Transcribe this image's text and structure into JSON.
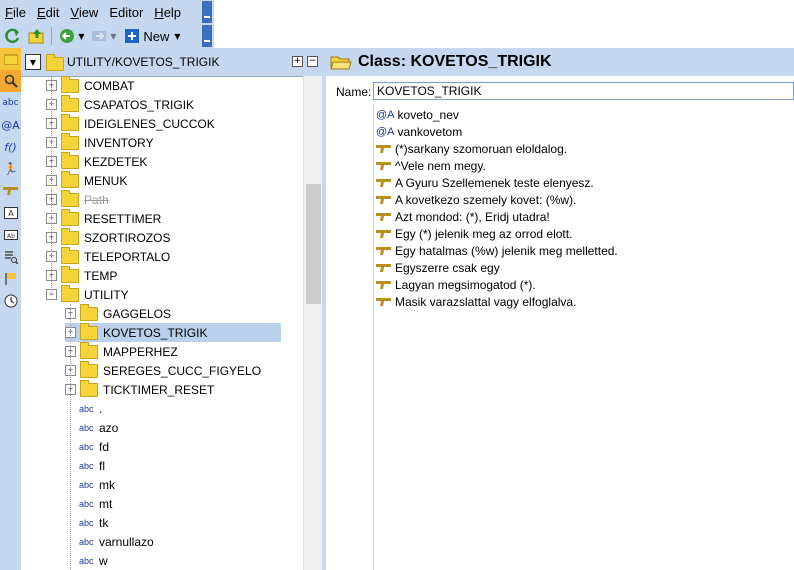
{
  "menu": {
    "items": [
      {
        "label": "File",
        "u": "F",
        "rest": "ile"
      },
      {
        "label": "Edit",
        "u": "E",
        "rest": "dit"
      },
      {
        "label": "View",
        "u": "V",
        "rest": "iew"
      },
      {
        "label": "Editor",
        "u": "",
        "rest": "Editor"
      },
      {
        "label": "Help",
        "u": "H",
        "rest": "elp"
      }
    ]
  },
  "toolbar": {
    "new_label": "New"
  },
  "tree": {
    "path": "UTILITY/KOVETOS_TRIGIK",
    "folders_top": [
      "COMBAT",
      "CSAPATOS_TRIGIK",
      "IDEIGLENES_CUCCOK",
      "INVENTORY",
      "KEZDETEK",
      "MENUK",
      "Path",
      "RESETTIMER",
      "SZORTIROZOS",
      "TELEPORTALO",
      "TEMP",
      "UTILITY"
    ],
    "utility_children": [
      "GAGGELOS",
      "KOVETOS_TRIGIK",
      "MAPPERHEZ",
      "SEREGES_CUCC_FIGYELO",
      "TICKTIMER_RESET"
    ],
    "variables": [
      ".",
      "azo",
      "fd",
      "fl",
      "mk",
      "mt",
      "tk",
      "varnullazo",
      "w"
    ],
    "abc_label": "abc"
  },
  "class_panel": {
    "title": "Class: KOVETOS_TRIGIK",
    "name_label": "Name:",
    "name_value": "KOVETOS_TRIGIK",
    "variables": [
      "koveto_nev",
      "vankovetom"
    ],
    "triggers": [
      "(*)sarkany szomoruan eloldalog.",
      "^Vele nem megy.",
      "A Gyuru Szellemenek teste elenyesz.",
      "A kovetkezo szemely kovet: (%w).",
      "Azt mondod: (*), Eridj utadra!",
      "Egy (*) jelenik meg az orrod elott.",
      "Egy hatalmas (%w) jelenik meg melletted.",
      "Egyszerre csak egy",
      "Lagyan megsimogatod (*).",
      "Masik varazslattal vagy elfoglalva."
    ]
  },
  "colors": {
    "chrome": "#c6d8f0",
    "selection": "#b9d1ea",
    "folder": "#f5d43a"
  }
}
